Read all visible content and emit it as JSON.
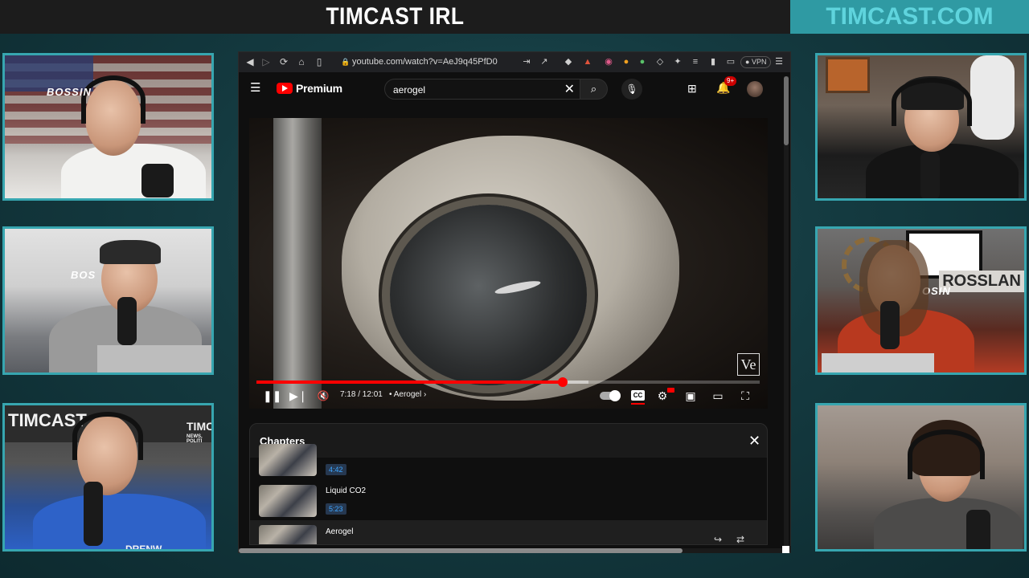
{
  "header": {
    "title": "TIMCAST IRL",
    "site": "TIMCAST.COM"
  },
  "tiles": {
    "t1_chair": "BOSSIN",
    "t2_chair": "BOS",
    "t3_sign_left": "TIMCAST",
    "t3_sign_right": "TIMC",
    "t3_sign_sub": "NEWS, POLITI",
    "t3_shirt": "DRENW",
    "t5_chair": "OSIN",
    "t5_sign": "ROSSLAN"
  },
  "browser": {
    "url": "youtube.com/watch?v=AeJ9q45PfD0",
    "vpn_label": "VPN",
    "youtube": {
      "brand": "Premium",
      "search_value": "aerogel",
      "notification_count": "9+",
      "player": {
        "current_time": "7:18",
        "duration": "12:01",
        "time_display": "7:18 / 12:01",
        "chapter_name": "Aerogel",
        "progress_fraction": 0.608,
        "loaded_fraction": 0.66,
        "watermark": "Ve",
        "cc_label": "CC"
      },
      "chapters": {
        "title": "Chapters",
        "items": [
          {
            "name": "",
            "time": "4:42"
          },
          {
            "name": "Liquid CO2",
            "time": "5:23"
          },
          {
            "name": "Aerogel",
            "time": ""
          }
        ]
      }
    }
  },
  "icons": {
    "back": "arrow-left-icon",
    "forward": "arrow-right-icon",
    "reload": "reload-icon",
    "home": "home-icon",
    "bookmark": "bookmark-icon",
    "lock": "lock-icon",
    "search": "search-icon",
    "mic": "mic-icon",
    "create": "create-video-icon",
    "bell": "bell-icon",
    "play_pause": "pause-icon",
    "next": "skip-next-icon",
    "mute": "volume-muted-icon",
    "settings": "gear-icon",
    "miniplayer": "miniplayer-icon",
    "theater": "theater-mode-icon",
    "fullscreen": "fullscreen-icon",
    "close": "close-icon",
    "share": "share-icon",
    "loop": "loop-icon"
  },
  "colors": {
    "accent_teal": "#37a6b0",
    "youtube_red": "#ff0000",
    "chapter_time_blue": "#3ea6ff"
  }
}
